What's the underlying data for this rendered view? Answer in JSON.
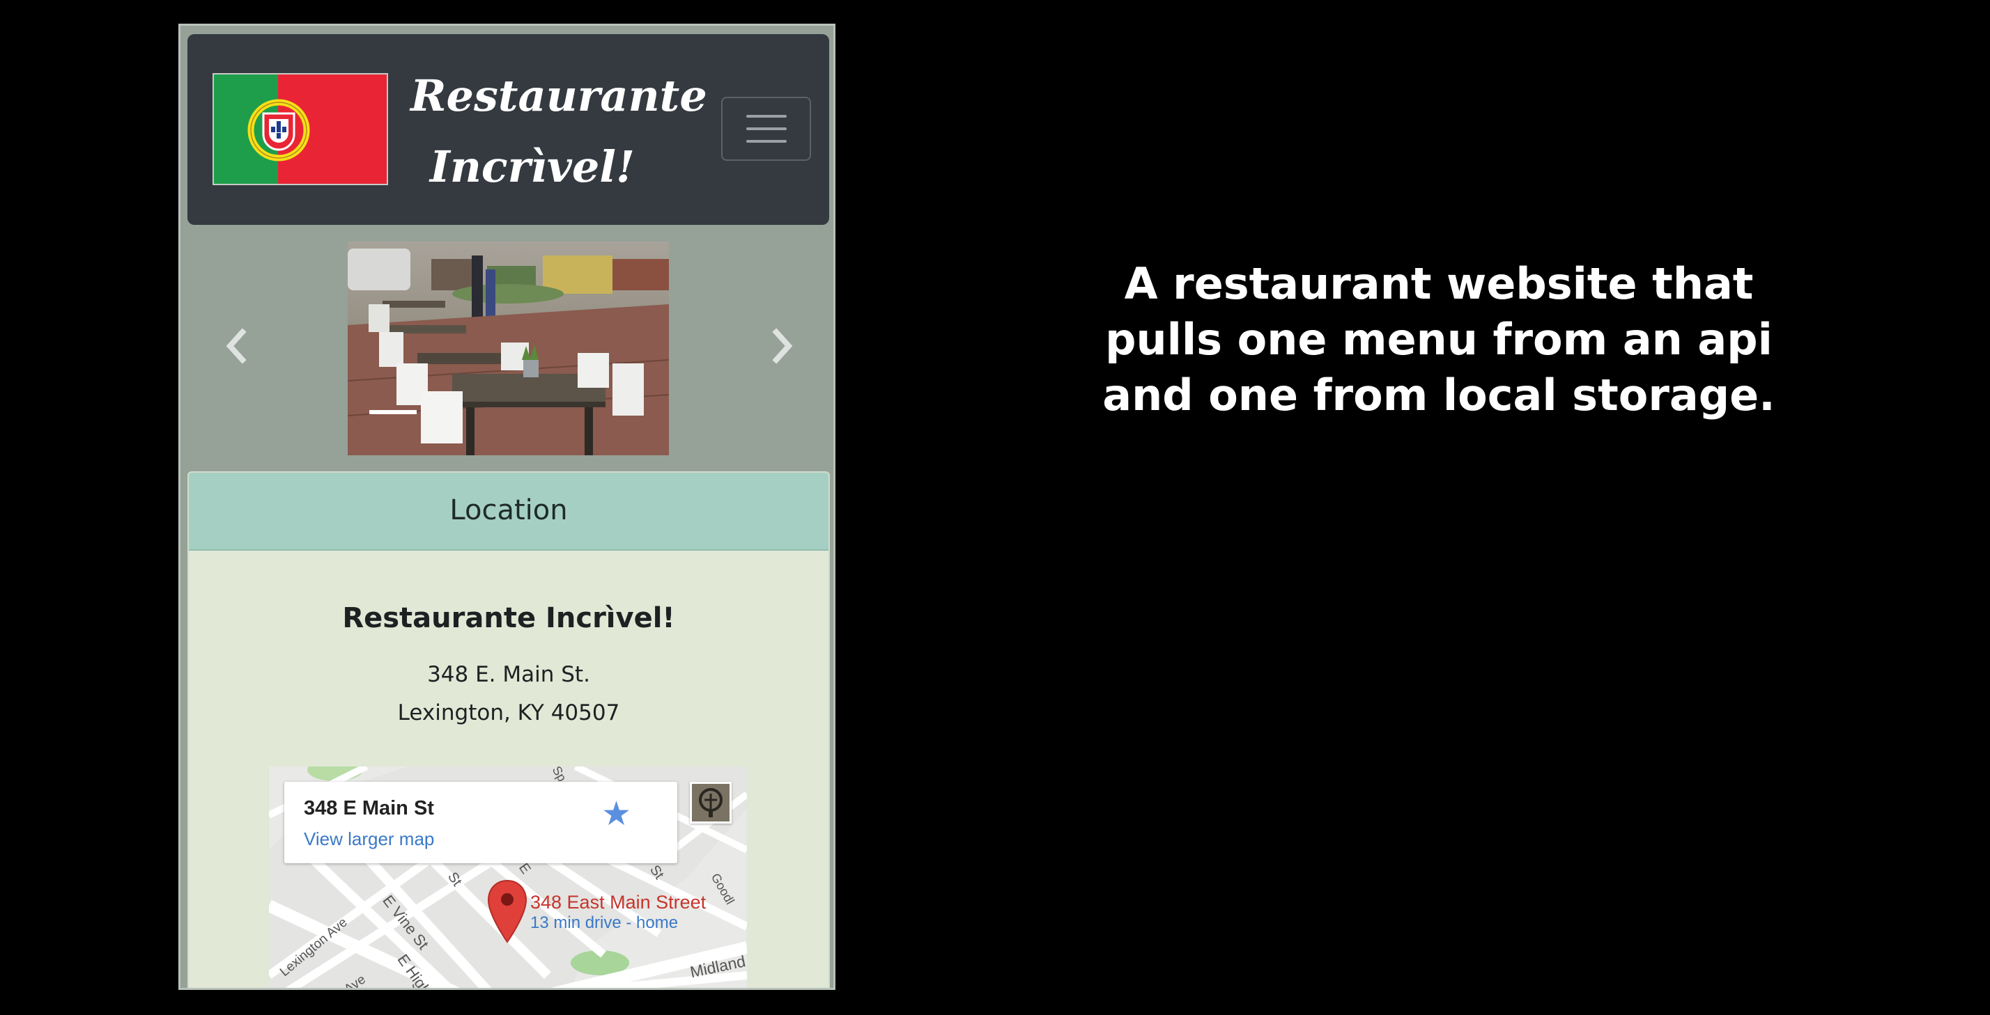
{
  "navbar": {
    "flag_icon": "portugal-flag-icon",
    "brand_line1": "Restaurante",
    "brand_line2": "Incrìvel!",
    "toggler_icon": "hamburger-menu-icon",
    "colors": {
      "background": "#343a40",
      "brand_text": "#ffffff"
    }
  },
  "carousel": {
    "image": "outdoor-restaurant-patio-photo",
    "prev_icon": "chevron-left-icon",
    "next_icon": "chevron-right-icon",
    "slide_count_visible": 1,
    "active_indicator": 1
  },
  "location": {
    "header": "Location",
    "name": "Restaurante Incrìvel!",
    "address_line1": "348 E. Main St.",
    "address_line2": "Lexington, KY 40507",
    "colors": {
      "header_bg": "#a5cfc2",
      "body_bg": "#e1e8d6"
    }
  },
  "map": {
    "place_title": "348 E Main St",
    "larger_map_link": "View larger map",
    "star_icon": "star-icon",
    "pin_icon": "map-pin-icon",
    "pin_label": "348 East Main Street",
    "pin_sublabel": "13 min drive - home",
    "streets": {
      "lexington": "Lexington Ave",
      "vine": "E Vine St",
      "high": "E High St",
      "stone": "Stone Ave",
      "midland": "Midland",
      "st1": "St",
      "st2": "St",
      "e": "E",
      "sp": "Sp",
      "goodl": "Goodl",
      "diana": "Midland Ave"
    }
  },
  "caption": {
    "line1": "A restaurant website that",
    "line2": "pulls one menu from an api",
    "line3": "and one from local storage."
  }
}
